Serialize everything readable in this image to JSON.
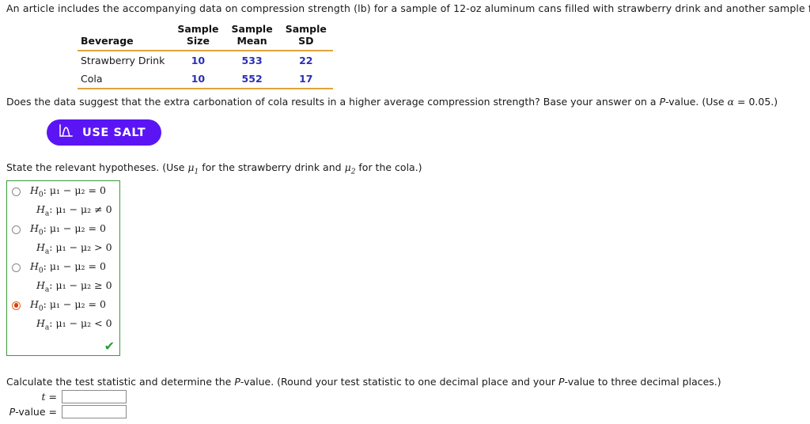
{
  "intro": {
    "text": "An article includes the accompanying data on compression strength (lb) for a sample of 12-oz aluminum cans filled with strawberry drink and another sample filled with cola."
  },
  "table": {
    "headers": {
      "beverage": "Beverage",
      "sample_size_l1": "Sample",
      "sample_size_l2": "Size",
      "sample_mean_l1": "Sample",
      "sample_mean_l2": "Mean",
      "sample_sd_l1": "Sample",
      "sample_sd_l2": "SD"
    },
    "rows": [
      {
        "beverage": "Strawberry Drink",
        "size": "10",
        "mean": "533",
        "sd": "22"
      },
      {
        "beverage": "Cola",
        "size": "10",
        "mean": "552",
        "sd": "17"
      }
    ],
    "rule_color": "#e0a33e",
    "value_color": "#2b2fb5"
  },
  "question": {
    "part1": "Does the data suggest that the extra carbonation of cola results in a higher average compression strength? Base your answer on a ",
    "pvalue": "P",
    "part2": "-value. (Use ",
    "alpha": "α",
    "part3": " = 0.05.)"
  },
  "salt_button": {
    "label": "USE SALT",
    "icon": "normal-curve-icon",
    "background": "#5b15f5",
    "text_color": "#ffffff"
  },
  "hypotheses": {
    "prompt_part1": "State the relevant hypotheses. (Use ",
    "mu1": "μ",
    "mu1_sub": "1",
    "prompt_part2": " for the strawberry drink and ",
    "mu2": "μ",
    "mu2_sub": "2",
    "prompt_part3": " for the cola.)",
    "box_border_color": "#3a9a3a",
    "selected_index": 3,
    "correct_mark": "✔",
    "correct_mark_color": "#2e9e37",
    "options": [
      {
        "h0_name": "H",
        "h0_sub": "0",
        "h0_body": "μ₁ − μ₂ = 0",
        "ha_name": "H",
        "ha_sub": "a",
        "ha_body": "μ₁ − μ₂ ≠ 0",
        "selected": false
      },
      {
        "h0_name": "H",
        "h0_sub": "0",
        "h0_body": "μ₁ − μ₂ = 0",
        "ha_name": "H",
        "ha_sub": "a",
        "ha_body": "μ₁ − μ₂ > 0",
        "selected": false
      },
      {
        "h0_name": "H",
        "h0_sub": "0",
        "h0_body": "μ₁ − μ₂ = 0",
        "ha_name": "H",
        "ha_sub": "a",
        "ha_body": "μ₁ − μ₂ ≥ 0",
        "selected": false
      },
      {
        "h0_name": "H",
        "h0_sub": "0",
        "h0_body": "μ₁ − μ₂ = 0",
        "ha_name": "H",
        "ha_sub": "a",
        "ha_body": "μ₁ − μ₂ < 0",
        "selected": true
      }
    ]
  },
  "calculate": {
    "prompt_part1": "Calculate the test statistic and determine the ",
    "prompt_p1": "P",
    "prompt_part2": "-value. (Round your test statistic to one decimal place and your ",
    "prompt_p2": "P",
    "prompt_part3": "-value to three decimal places.)",
    "t_label": "t",
    "t_eq": " = ",
    "t_value": "",
    "p_label": "P",
    "p_label_rest": "-value",
    "p_eq": " = ",
    "p_value": ""
  }
}
